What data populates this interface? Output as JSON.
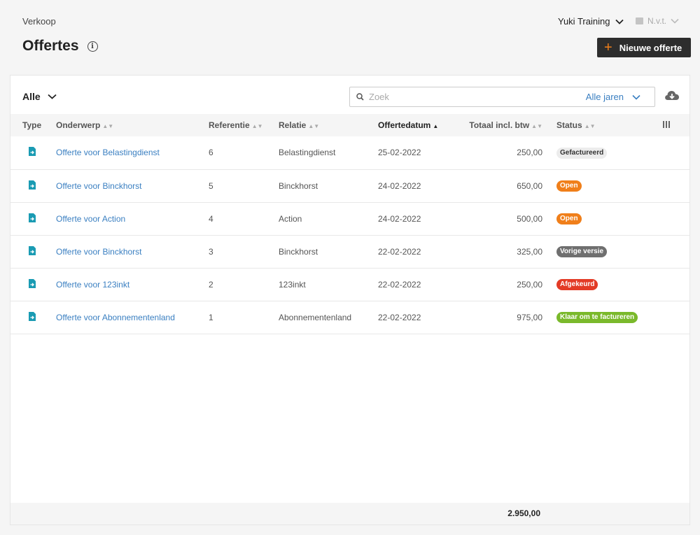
{
  "header": {
    "breadcrumb": "Verkoop",
    "title": "Offertes",
    "organisation": "Yuki Training",
    "period": "N.v.t.",
    "new_button": "Nieuwe offerte"
  },
  "toolbar": {
    "filter": "Alle",
    "search_placeholder": "Zoek",
    "years": "Alle jaren"
  },
  "table": {
    "columns": {
      "type": "Type",
      "subject": "Onderwerp",
      "reference": "Referentie",
      "relation": "Relatie",
      "date": "Offertedatum",
      "total": "Totaal incl. btw",
      "status": "Status"
    },
    "rows": [
      {
        "subject": "Offerte voor Belastingdienst",
        "reference": "6",
        "relation": "Belastingdienst",
        "date": "25-02-2022",
        "total": "250,00",
        "status": "Gefactureerd",
        "status_color": "#ececec"
      },
      {
        "subject": "Offerte voor Binckhorst",
        "reference": "5",
        "relation": "Binckhorst",
        "date": "24-02-2022",
        "total": "650,00",
        "status": "Open",
        "status_color": "#f07f1a"
      },
      {
        "subject": "Offerte voor Action",
        "reference": "4",
        "relation": "Action",
        "date": "24-02-2022",
        "total": "500,00",
        "status": "Open",
        "status_color": "#f07f1a"
      },
      {
        "subject": "Offerte voor Binckhorst",
        "reference": "3",
        "relation": "Binckhorst",
        "date": "22-02-2022",
        "total": "325,00",
        "status": "Vorige versie",
        "status_color": "#6f6f6f"
      },
      {
        "subject": "Offerte voor 123inkt",
        "reference": "2",
        "relation": "123inkt",
        "date": "22-02-2022",
        "total": "250,00",
        "status": "Afgekeurd",
        "status_color": "#e33b26"
      },
      {
        "subject": "Offerte voor Abonnementenland",
        "reference": "1",
        "relation": "Abonnementenland",
        "date": "22-02-2022",
        "total": "975,00",
        "status": "Klaar om te factureren",
        "status_color": "#7ab92b"
      }
    ],
    "grand_total": "2.950,00"
  },
  "icons": [
    "info-icon",
    "plus-icon",
    "chevron-down-icon",
    "calendar-icon",
    "search-icon",
    "cloud-download-icon",
    "quote-document-icon",
    "column-settings-icon",
    "sort-icon"
  ],
  "colors": {
    "accent": "#f07f1a",
    "link": "#3a7fc1",
    "doc_icon": "#1a9bb3"
  }
}
